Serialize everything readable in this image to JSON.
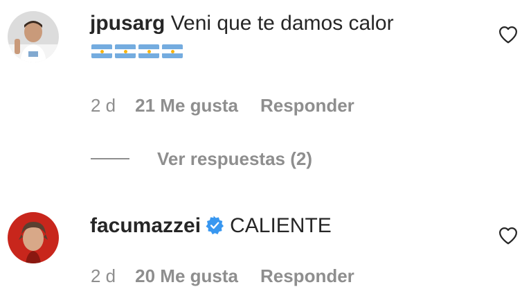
{
  "comments": [
    {
      "username": "jpusarg",
      "text": "Veni que te damos calor",
      "emoji": [
        "argentina-flag",
        "argentina-flag",
        "argentina-flag",
        "argentina-flag"
      ],
      "time": "2 d",
      "likes": "21 Me gusta",
      "reply_label": "Responder",
      "view_replies": "Ver respuestas (2)"
    },
    {
      "username": "facumazzei",
      "verified": true,
      "text": "CALIENTE",
      "time": "2 d",
      "likes": "20 Me gusta",
      "reply_label": "Responder"
    }
  ],
  "colors": {
    "text": "#262626",
    "muted": "#8e8e8e",
    "verified": "#3897f0",
    "flag_blue": "#74acdf",
    "flag_sun": "#f6b40e"
  }
}
